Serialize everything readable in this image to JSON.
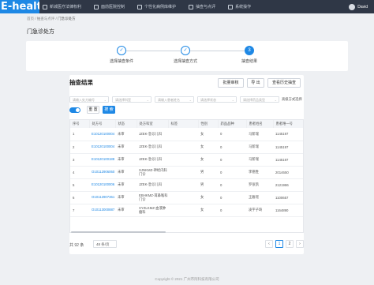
{
  "app": {
    "logo": "E-health"
  },
  "nav": {
    "items": [
      {
        "label": "新城医疗法律权利",
        "icon": "law-icon"
      },
      {
        "label": "面前医院控制",
        "icon": "monitor-icon"
      },
      {
        "label": "个性化病例库维护",
        "icon": "database-icon"
      },
      {
        "label": "抽查与点评",
        "icon": "review-icon"
      },
      {
        "label": "系统操作",
        "icon": "settings-icon"
      }
    ],
    "user": "David"
  },
  "breadcrumb": {
    "items": [
      "首页",
      "抽查与点评",
      "门急诊处方"
    ],
    "separator": " / "
  },
  "page_title": "门急诊处方",
  "steps": [
    {
      "label": "选择抽查条件",
      "mark": "✓",
      "state": "done"
    },
    {
      "label": "选择抽查方式",
      "mark": "✓",
      "state": "done"
    },
    {
      "label": "抽查结果",
      "mark": "3",
      "state": "active"
    }
  ],
  "result": {
    "title": "抽查结果",
    "buttons": {
      "batch_review": "批量审核",
      "export": "导 出",
      "history": "查看历史抽查"
    },
    "filters": [
      {
        "placeholder": "请输入处方编号"
      },
      {
        "placeholder": "请选择科室"
      },
      {
        "placeholder": "请输入患者姓名"
      },
      {
        "placeholder": "请选择状态"
      },
      {
        "placeholder": "请选择药品类型"
      }
    ],
    "filter_link": "高级方式选择",
    "reset_label": "重 置",
    "search_label": "搜 索",
    "columns": [
      "序号",
      "处方号",
      "状态",
      "处方科室",
      "标签",
      "性别",
      "药品品种",
      "患者姓名",
      "患者唯一号"
    ],
    "rows": [
      {
        "no": "1",
        "rx": "E10120100004",
        "status": "未审",
        "dept": "JZEK-急诊儿科",
        "tag": "",
        "sex": "女",
        "drugs": "0",
        "name": "马新瑞",
        "uid": "1145197"
      },
      {
        "no": "2",
        "rx": "E10120100004",
        "status": "未审",
        "dept": "JZEK-急诊儿科",
        "tag": "",
        "sex": "女",
        "drugs": "0",
        "name": "马新瑞",
        "uid": "1145197"
      },
      {
        "no": "3",
        "rx": "E10120100188",
        "status": "未审",
        "dept": "JZEK-急诊儿科",
        "tag": "",
        "sex": "女",
        "drugs": "0",
        "name": "马新瑞",
        "uid": "1145197"
      },
      {
        "no": "4",
        "rx": "O10112906060",
        "status": "未审",
        "dept": "SJNKMZ-神经内科门诊",
        "tag": "",
        "sex": "男",
        "drugs": "0",
        "name": "李德胜",
        "uid": "2014650"
      },
      {
        "no": "5",
        "rx": "E10120100006",
        "status": "未审",
        "dept": "JZEK-急诊儿科",
        "tag": "",
        "sex": "男",
        "drugs": "0",
        "name": "罗张凯",
        "uid": "2121986"
      },
      {
        "no": "6",
        "rx": "O10112907361",
        "status": "未审",
        "dept": "EBHKMZ-耳鼻喉科门诊",
        "tag": "",
        "sex": "女",
        "drugs": "0",
        "name": "王雅瑶",
        "uid": "1100657"
      },
      {
        "no": "7",
        "rx": "O10113000887",
        "status": "未审",
        "dept": "XYZLKMZ-血液肿瘤科",
        "tag": "",
        "sex": "女",
        "drugs": "0",
        "name": "凌宇子琦",
        "uid": "1164890"
      }
    ],
    "total": "共 92 条",
    "page_size": "48 条/页",
    "pages": [
      "‹",
      "1",
      "2",
      "›"
    ],
    "current_page": "1"
  },
  "copyright": "Copyright © 2021 广州市阿科技有限公司"
}
